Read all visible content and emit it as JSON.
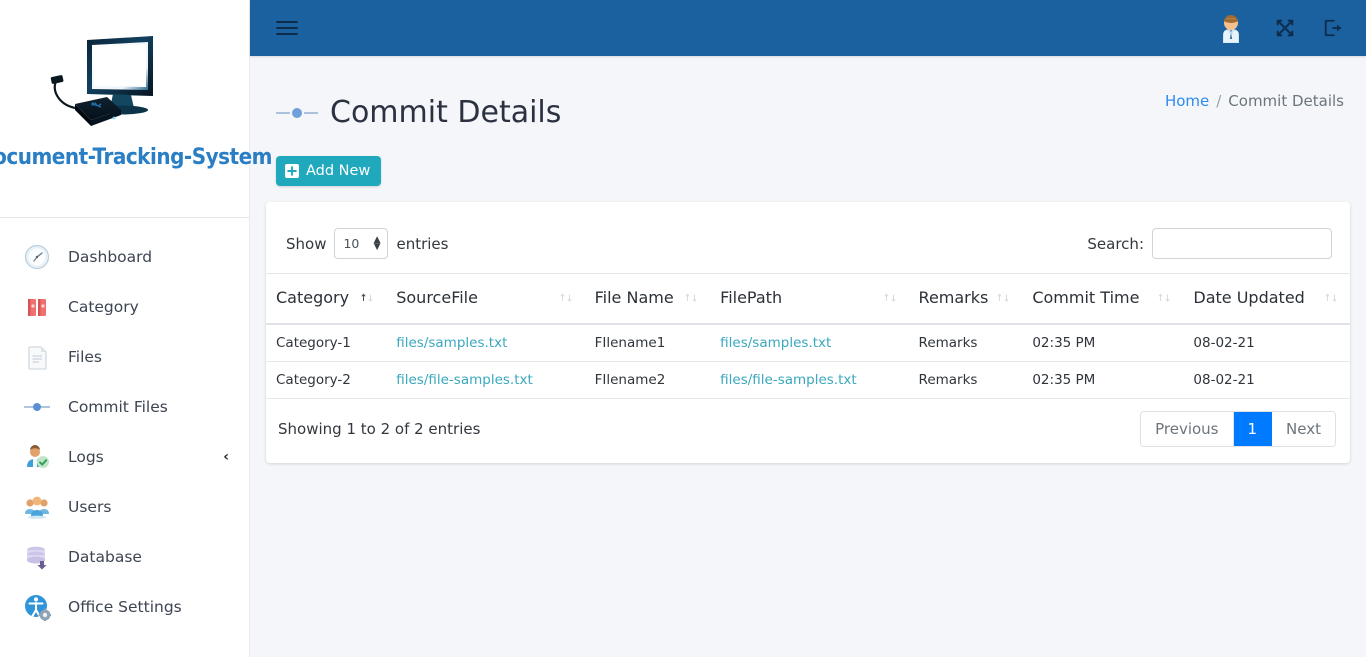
{
  "brand": {
    "name": "Document-Tracking-System",
    "logo_icon": "computer-and-external-drive-logo"
  },
  "sidebar": {
    "items": [
      {
        "label": "Dashboard",
        "icon": "clock-icon",
        "has_chevron": false
      },
      {
        "label": "Category",
        "icon": "binders-icon",
        "has_chevron": false
      },
      {
        "label": "Files",
        "icon": "document-icon",
        "has_chevron": false
      },
      {
        "label": "Commit Files",
        "icon": "commit-icon",
        "has_chevron": false
      },
      {
        "label": "Logs",
        "icon": "user-check-icon",
        "has_chevron": true,
        "chevron": "‹"
      },
      {
        "label": "Users",
        "icon": "users-group-icon",
        "has_chevron": false
      },
      {
        "label": "Database",
        "icon": "database-icon",
        "has_chevron": false
      },
      {
        "label": "Office Settings",
        "icon": "accessibility-gear-icon",
        "has_chevron": false
      }
    ]
  },
  "topbar": {
    "menu_icon": "hamburger-icon",
    "avatar_icon": "user-avatar-icon",
    "fullscreen_icon": "expand-arrows-icon",
    "logout_icon": "sign-out-icon",
    "bg_color": "#1b609f"
  },
  "page": {
    "title": "Commit Details",
    "title_icon": "commit-icon",
    "breadcrumb": {
      "home": "Home",
      "separator": "/",
      "current": "Commit Details"
    },
    "add_new_label": "Add New",
    "add_new_icon": "plus-square-icon",
    "add_new_color": "#20a8bd"
  },
  "datatable": {
    "show_label": "Show",
    "entries_label": "entries",
    "page_length": "10",
    "search_label": "Search:",
    "search_value": "",
    "search_placeholder": "",
    "columns": [
      "Category",
      "SourceFile",
      "File Name",
      "FilePath",
      "Remarks",
      "Commit Time",
      "Date Updated"
    ],
    "rows": [
      {
        "category": "Category-1",
        "sourcefile": "files/samples.txt",
        "filename": "FIlename1",
        "filepath": "files/samples.txt",
        "remarks": "Remarks",
        "commit_time": "02:35 PM",
        "date_updated": "08-02-21"
      },
      {
        "category": "Category-2",
        "sourcefile": "files/file-samples.txt",
        "filename": "FIlename2",
        "filepath": "files/file-samples.txt",
        "remarks": "Remarks",
        "commit_time": "02:35 PM",
        "date_updated": "08-02-21"
      }
    ],
    "info": "Showing 1 to 2 of 2 entries",
    "pagination": {
      "previous": "Previous",
      "pages": [
        "1"
      ],
      "active_page": "1",
      "next": "Next",
      "active_color": "#007bff"
    }
  }
}
